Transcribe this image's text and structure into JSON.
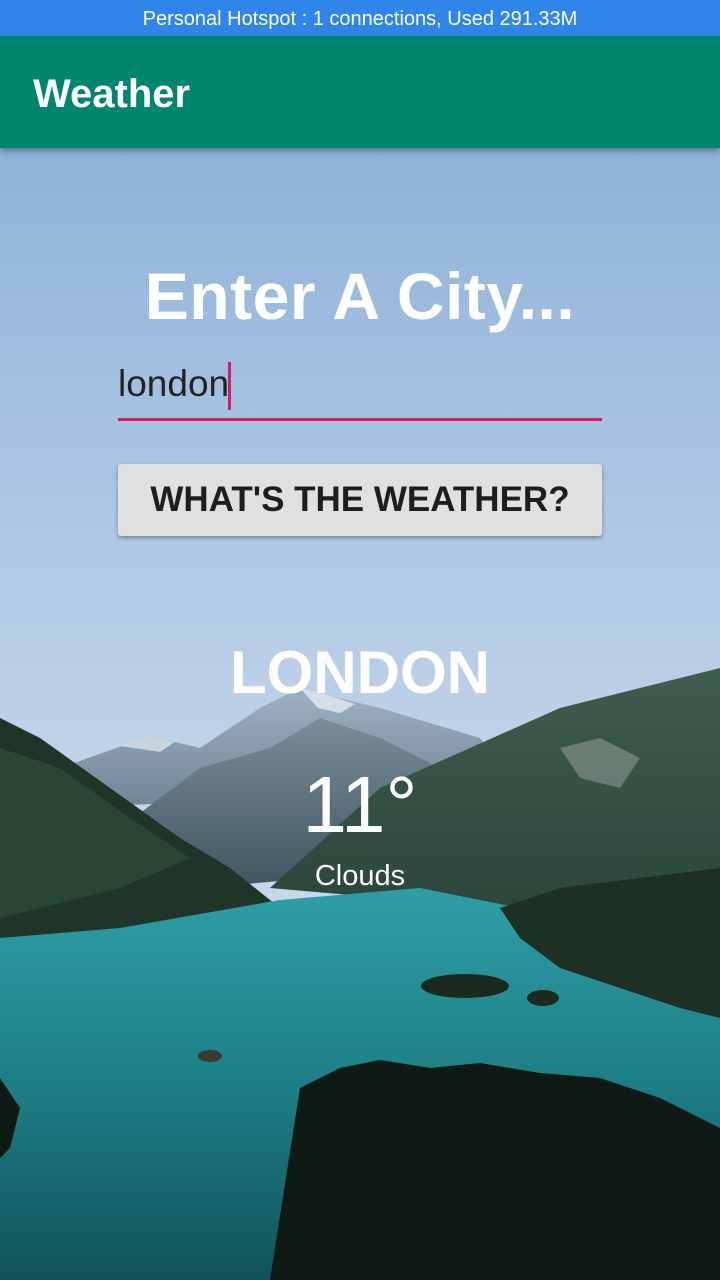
{
  "status_bar": {
    "text": "Personal Hotspot : 1 connections, Used 291.33M"
  },
  "app_bar": {
    "title": "Weather"
  },
  "main": {
    "heading": "Enter A City...",
    "city_input": {
      "value": "london"
    },
    "button_label": "WHAT'S THE WEATHER?",
    "result": {
      "city": "LONDON",
      "temperature": "11°",
      "description": "Clouds"
    }
  },
  "colors": {
    "status_bar": "#2f86e8",
    "app_bar": "#00856f",
    "accent": "#d81b60",
    "button": "#e0e0e0"
  }
}
